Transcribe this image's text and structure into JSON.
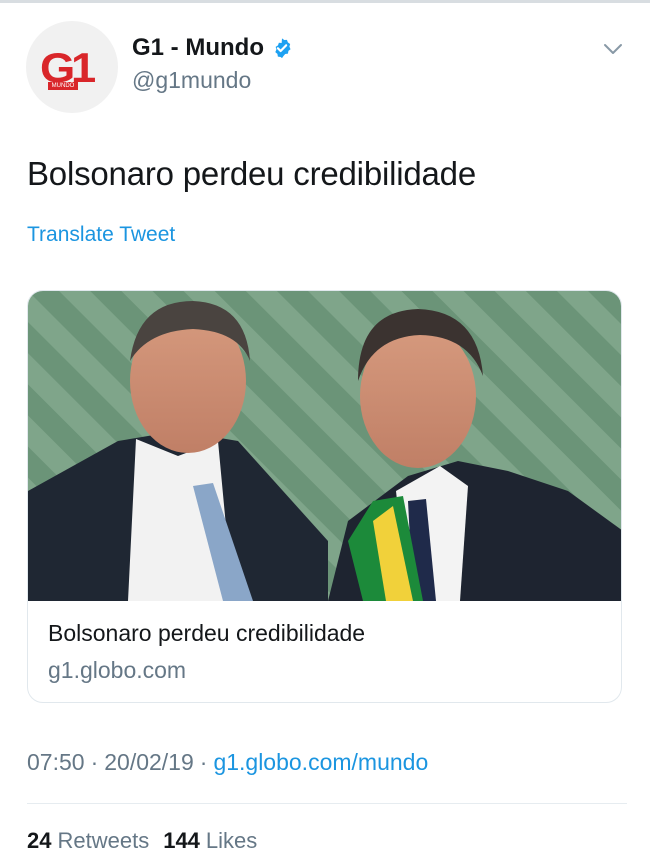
{
  "author": {
    "display_name": "G1 - Mundo",
    "handle": "@g1mundo",
    "logo_text": "G1",
    "logo_subtext": "MUNDO",
    "verified_icon": "verified-badge-icon"
  },
  "tweet": {
    "text": "Bolsonaro perdeu credibilidade",
    "translate_label": "Translate Tweet"
  },
  "card": {
    "image_icon": "photo",
    "title": "Bolsonaro perdeu credibilidade",
    "domain": "g1.globo.com"
  },
  "meta": {
    "time": "07:50",
    "date": "20/02/19",
    "separator": "·",
    "source_link": "g1.globo.com/mundo"
  },
  "stats": {
    "retweets_count": "24",
    "retweets_label": "Retweets",
    "likes_count": "144",
    "likes_label": "Likes"
  },
  "colors": {
    "link": "#1b95e0",
    "secondary_text": "#657786",
    "brand_red": "#d9262a",
    "verified_blue": "#1da1f2"
  }
}
